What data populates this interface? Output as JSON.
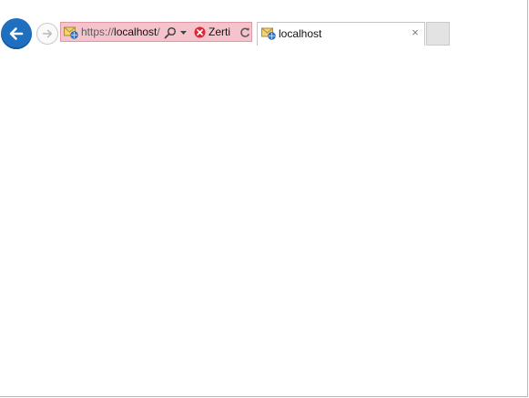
{
  "navigation": {
    "back_icon": "back-arrow-icon",
    "forward_icon": "forward-arrow-icon"
  },
  "address_bar": {
    "protocol": "https://",
    "host": "localhost",
    "path": "/",
    "certificate_label": "Zerti",
    "background_color": "#f6c3cc",
    "site_icon": "website-icon",
    "search_icon": "search-icon",
    "dropdown_icon": "chevron-down-icon",
    "certificate_icon": "certificate-error-icon",
    "refresh_icon": "refresh-icon"
  },
  "tabs": [
    {
      "title": "localhost",
      "icon": "website-icon",
      "close_icon": "close-icon",
      "close_glyph": "×"
    }
  ],
  "colors": {
    "back_button": "#1e6fbf",
    "error_red": "#d72a37"
  }
}
